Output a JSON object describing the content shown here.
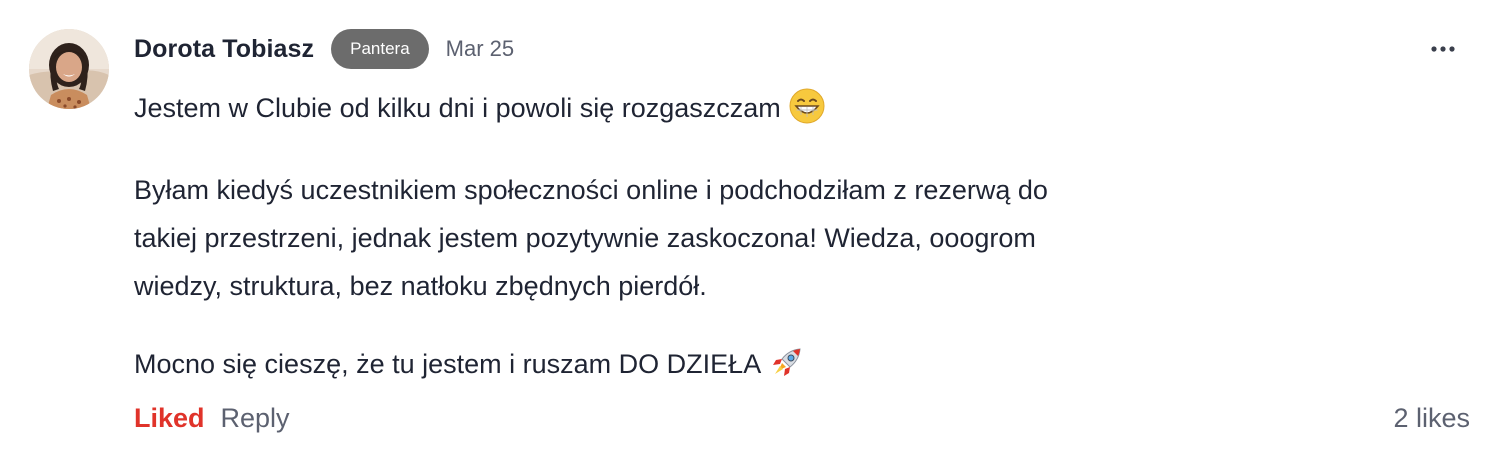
{
  "comment": {
    "author": "Dorota Tobiasz",
    "badge": "Pantera",
    "date": "Mar 25",
    "more_icon": "more-horizontal-icon",
    "avatar_icon": "user-avatar-photo",
    "paragraphs": {
      "first": "Jestem w Clubie od kilku dni i powoli się rozgaszczam",
      "first_emoji": "grinning-face-with-smiling-eyes-icon",
      "second_line1": "Byłam kiedyś uczestnikiem społeczności online i podchodziłam z rezerwą do",
      "second_line2": "takiej przestrzeni, jednak jestem pozytywnie zaskoczona! Wiedza, ooogrom",
      "second_line3": "wiedzy, struktura, bez natłoku zbędnych pierdół.",
      "third": "Mocno się cieszę, że tu jestem i ruszam DO DZIEŁA",
      "third_emoji": "rocket-icon"
    },
    "actions": {
      "liked_label": "Liked",
      "reply_label": "Reply",
      "likes_count": "2 likes"
    },
    "colors": {
      "liked": "#e0332a",
      "badge_bg": "#6c6c6c",
      "text": "#1f2433",
      "muted": "#5c6170"
    }
  }
}
